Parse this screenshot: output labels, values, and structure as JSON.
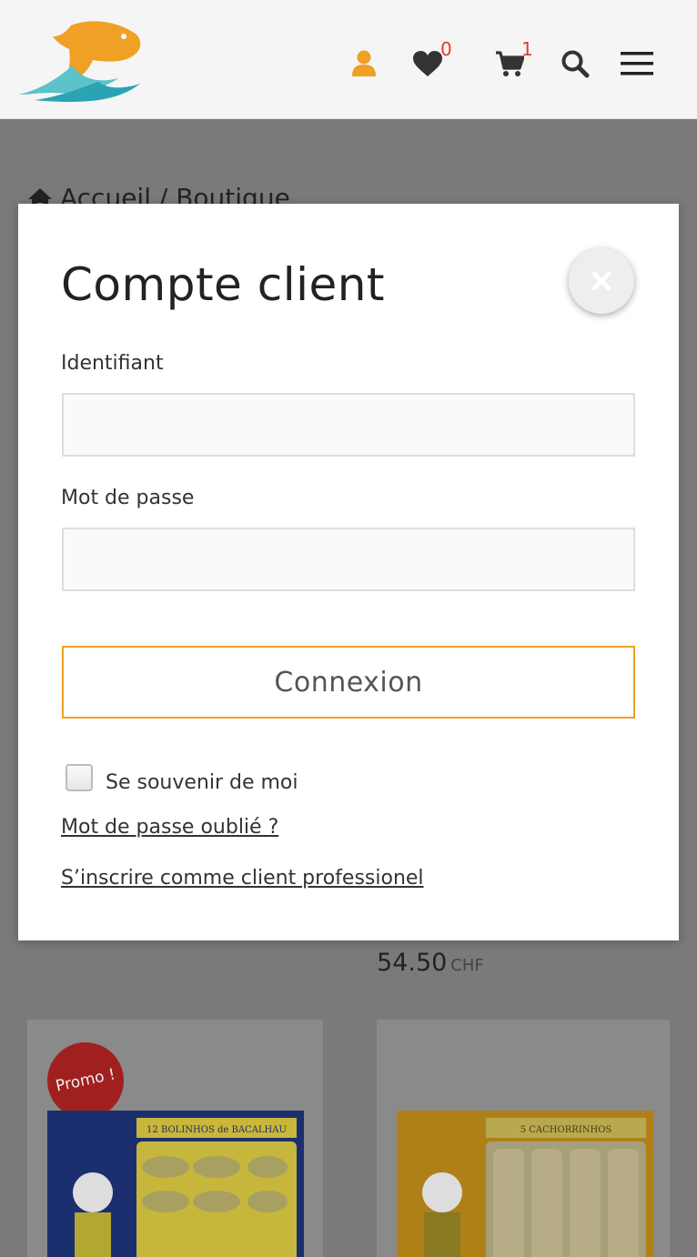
{
  "header": {
    "wishlist_count": "0",
    "cart_count": "1",
    "colors": {
      "accent": "#f0a024",
      "badge": "#e53935",
      "icon": "#333333"
    }
  },
  "page": {
    "breadcrumb": "Accueil / Boutique",
    "price_value": "54.50",
    "price_currency": "CHF",
    "promo_label": "Promo !",
    "products": [
      {
        "pack_title": "12 BOLINHOS de BACALHAU"
      },
      {
        "pack_title": "5 CACHORRINHOS"
      }
    ]
  },
  "modal": {
    "title": "Compte client",
    "username_label": "Identifiant",
    "username_value": "",
    "password_label": "Mot de passe",
    "password_value": "",
    "login_button": "Connexion",
    "remember_label": "Se souvenir de moi",
    "forgot_link": "Mot de passe oublié ?",
    "register_link": "S’inscrire comme client professionel"
  }
}
